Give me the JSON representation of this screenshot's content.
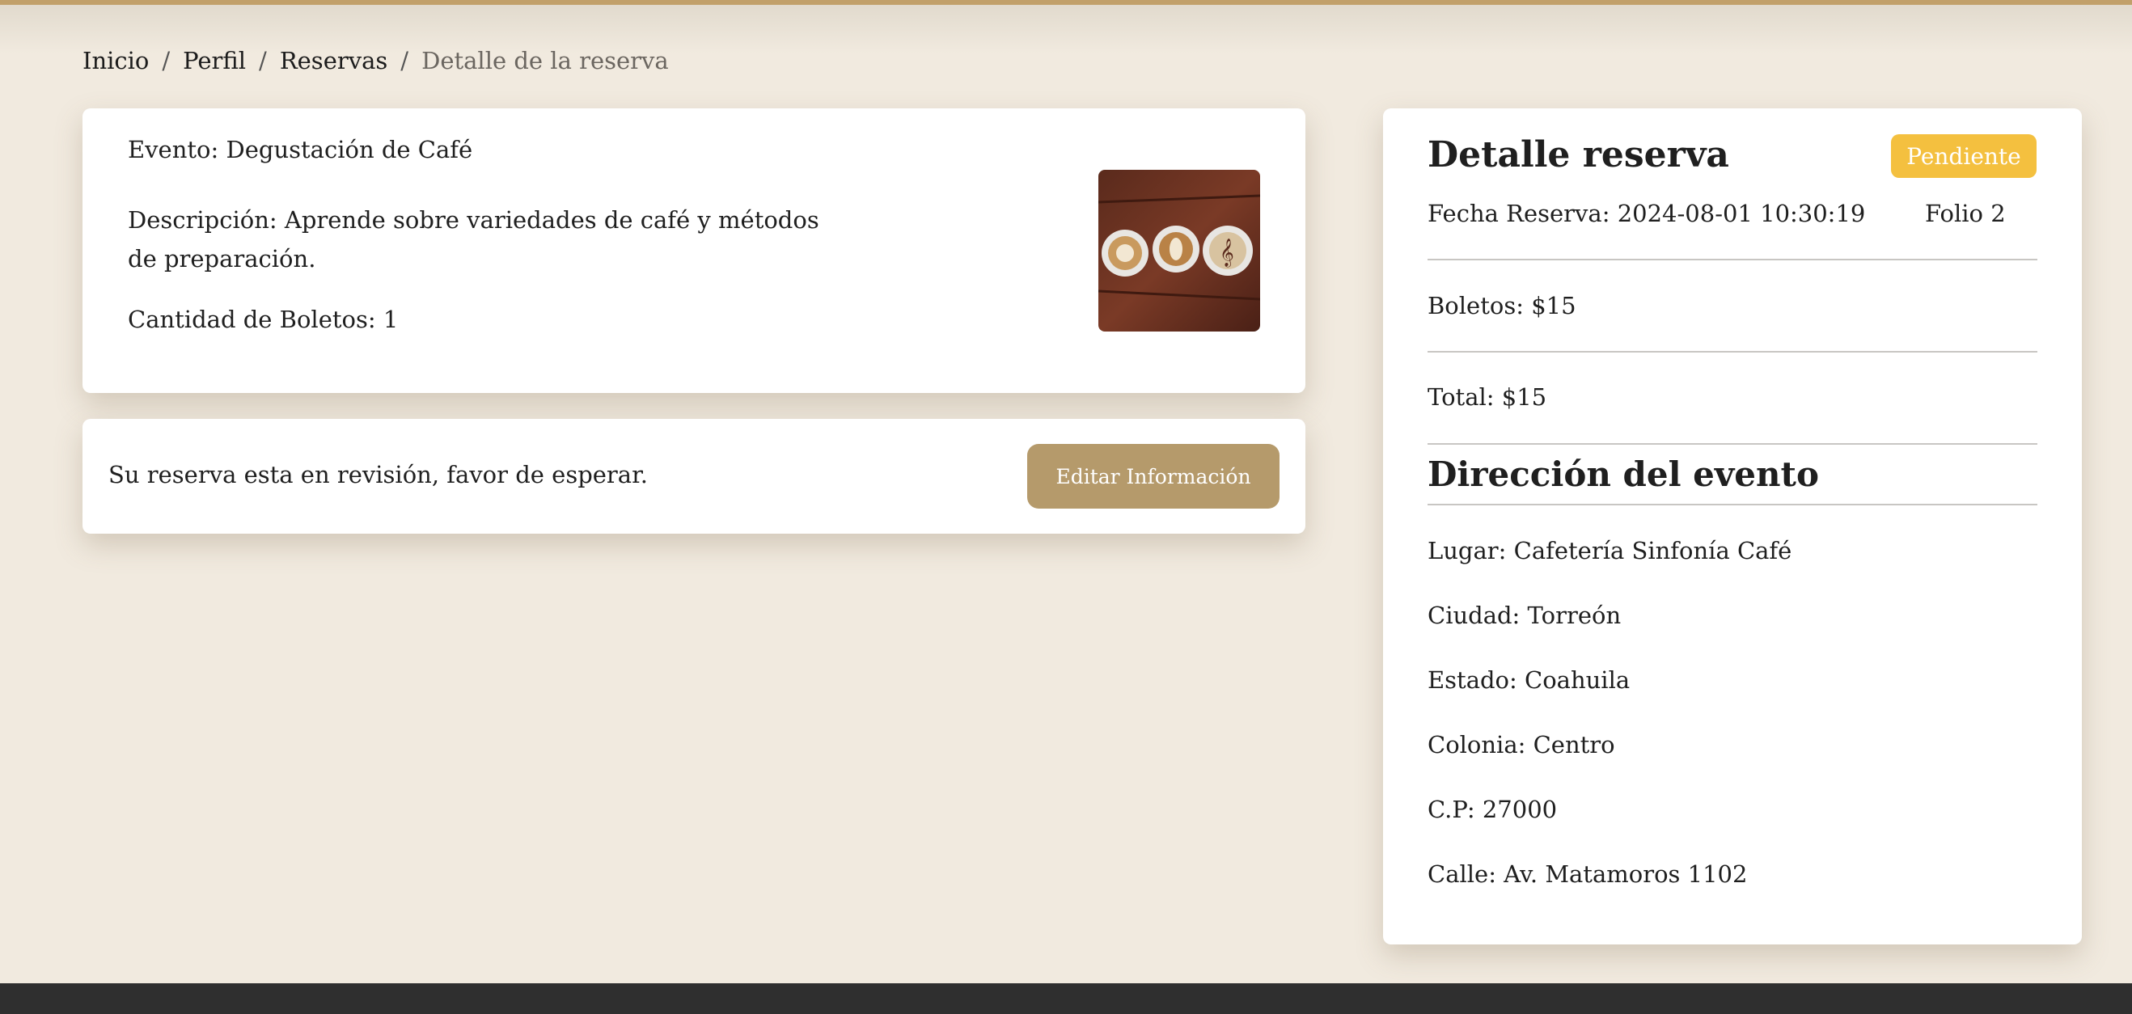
{
  "breadcrumb": {
    "items": [
      "Inicio",
      "Perfil",
      "Reservas"
    ],
    "current": "Detalle de la reserva",
    "separator": "/"
  },
  "event": {
    "name": "Evento: Degustación de Café",
    "description": "Descripción: Aprende sobre variedades de café y métodos de preparación.",
    "tickets": "Cantidad de Boletos: 1",
    "image_icon": "coffee-cups-image"
  },
  "status": {
    "message": "Su reserva esta en revisión, favor de esperar.",
    "edit_label": "Editar Información"
  },
  "detail": {
    "title": "Detalle reserva",
    "badge": "Pendiente",
    "date": "Fecha Reserva: 2024-08-01 10:30:19",
    "folio": "Folio 2",
    "tickets_price": "Boletos: $15",
    "total": "Total: $15"
  },
  "address": {
    "title": "Dirección del evento",
    "place": "Lugar: Cafetería Sinfonía Café",
    "city": "Ciudad: Torreón",
    "state": "Estado: Coahuila",
    "colony": "Colonia: Centro",
    "zip": "C.P: 27000",
    "street": "Calle: Av. Matamoros 1102"
  },
  "colors": {
    "accent": "#c1a06a",
    "button": "#b59a6b",
    "badge": "#f4c03f",
    "background": "#f1eadf",
    "footer": "#2f2f2f"
  }
}
